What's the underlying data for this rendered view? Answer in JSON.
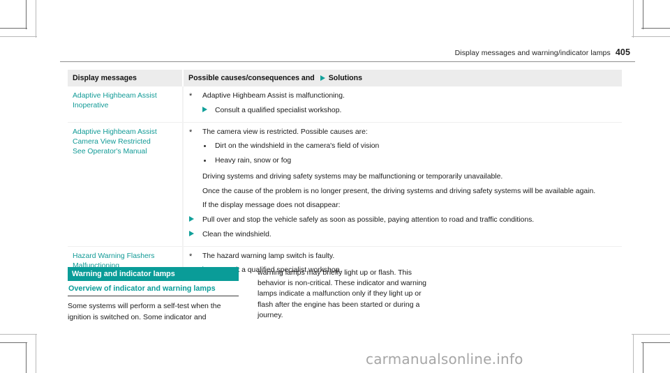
{
  "page_header": {
    "title": "Display messages and warning/indicator lamps",
    "page_number": "405"
  },
  "table": {
    "columns": [
      {
        "label": "Display messages"
      },
      {
        "label_before_icon": "Possible causes/consequences and",
        "icon": "solutions-triangle-icon",
        "label_after_icon": "Solutions"
      }
    ],
    "rows": [
      {
        "message_lines": [
          "Adaptive Highbeam Assist",
          "Inoperative"
        ],
        "blocks": [
          {
            "kind": "cause",
            "marker": "*",
            "text": "Adaptive Highbeam Assist is malfunctioning."
          },
          {
            "kind": "solution",
            "text": "Consult a qualified specialist workshop."
          }
        ]
      },
      {
        "message_lines": [
          "Adaptive Highbeam Assist",
          "Camera View Restricted",
          "See Operator's Manual"
        ],
        "blocks": [
          {
            "kind": "cause",
            "marker": "*",
            "text": "The camera view is restricted. Possible causes are:"
          },
          {
            "kind": "bullet",
            "text": "Dirt on the windshield in the camera's field of vision"
          },
          {
            "kind": "bullet",
            "text": "Heavy rain, snow or fog"
          },
          {
            "kind": "para",
            "text": "Driving systems and driving safety systems may be malfunctioning or temporarily unavailable."
          },
          {
            "kind": "para",
            "text": "Once the cause of the problem is no longer present, the driving systems and driving safety systems will be available again."
          },
          {
            "kind": "para",
            "text": "If the display message does not disappear:"
          },
          {
            "kind": "solution-l0",
            "text": "Pull over and stop the vehicle safely as soon as possible, paying attention to road and traffic conditions."
          },
          {
            "kind": "solution-l0",
            "text": "Clean the windshield."
          }
        ]
      },
      {
        "message_lines": [
          "Hazard Warning Flashers",
          "Malfunctioning"
        ],
        "blocks": [
          {
            "kind": "cause",
            "marker": "*",
            "text": "The hazard warning lamp switch is faulty."
          },
          {
            "kind": "solution",
            "text": "Consult a qualified specialist workshop."
          }
        ]
      }
    ]
  },
  "bottom_section": {
    "banner_title": "Warning and indicator lamps",
    "sub_heading": "Overview of indicator and warning lamps",
    "left_paragraph": "Some systems will perform a self-test when the ignition is switched on. Some indicator and",
    "right_paragraph": "warning lamps may briefly light up or flash. This behavior is non-critical. These indicator and warning lamps indicate a malfunction only if they light up or flash after the engine has been started or during a journey."
  },
  "watermark": {
    "text": "carmanualsonline.info"
  },
  "colors": {
    "teal": "#0a9c98",
    "message_teal": "#119a96",
    "header_bg": "#ececec",
    "watermark_gray": "#a6a6a6"
  }
}
